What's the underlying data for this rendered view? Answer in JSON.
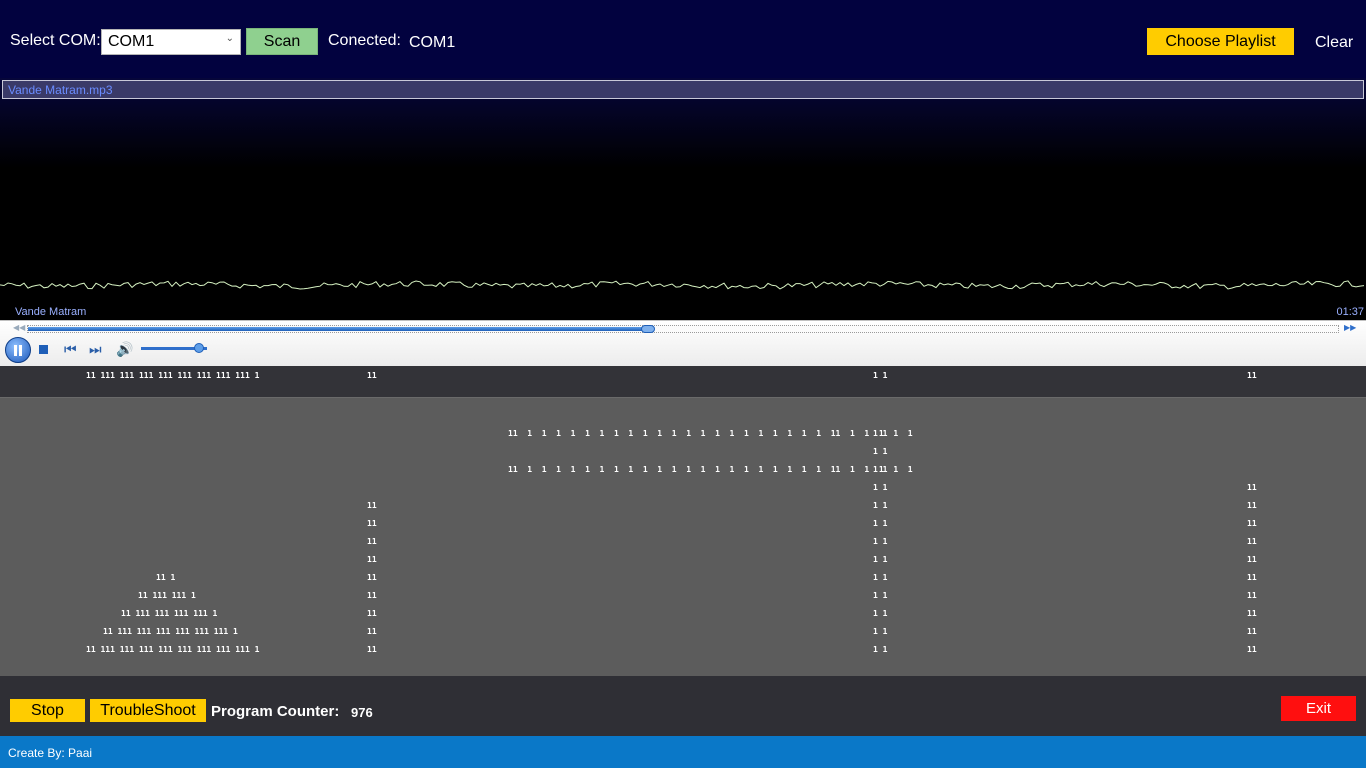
{
  "topbar": {
    "select_com_label": "Select COM:",
    "com_value": "COM1",
    "scan_label": "Scan",
    "connected_label": "Conected:",
    "connected_value": "COM1",
    "choose_playlist_label": "Choose Playlist",
    "clear_label": "Clear"
  },
  "player": {
    "playlist_item": "Vande Matram.mp3",
    "track_title": "Vande Matram",
    "time": "01:37",
    "seek_progress": 0.473,
    "volume_level": 0.88,
    "icons": [
      "rewind-icon",
      "forward-icon",
      "pause-icon",
      "stop-icon",
      "previous-icon",
      "next-icon",
      "volume-icon"
    ]
  },
  "channels": {
    "header_groups": [
      "11 111 111 111 111 111 111 111 111 1",
      "11",
      "1 1",
      "11"
    ],
    "pyramid": [
      "11 1",
      "11 111 111 1",
      "11 111 111 111 111 1",
      "11 111 111 111 111 111 111 1",
      "11 111 111 111 111 111 111 111 111 1"
    ],
    "beam_rows": [
      "11  1  1  1  1  1  1  1  1  1  1  1  1  1  1  1  1  1  1  1  1  1  11  1  1  1  1  1",
      "11  1  1  1  1  1  1  1  1  1  1  1  1  1  1  1  1  1  1  1  1  1  11  1  1  1  1  1"
    ],
    "col_a": "11",
    "col_b": "1 1",
    "col_c": "11"
  },
  "bottom": {
    "stop_label": "Stop",
    "troubleshoot_label": "TroubleShoot",
    "program_counter_label": "Program Counter:",
    "program_counter_value": "976",
    "exit_label": "Exit"
  },
  "status": {
    "creator": "Create By: Paai"
  },
  "colors": {
    "topbar_bg": "#02023f",
    "accent_yellow": "#ffcc00",
    "scan_green": "#8fd08f",
    "exit_red": "#ff0f0f",
    "status_blue": "#0a78c8"
  }
}
